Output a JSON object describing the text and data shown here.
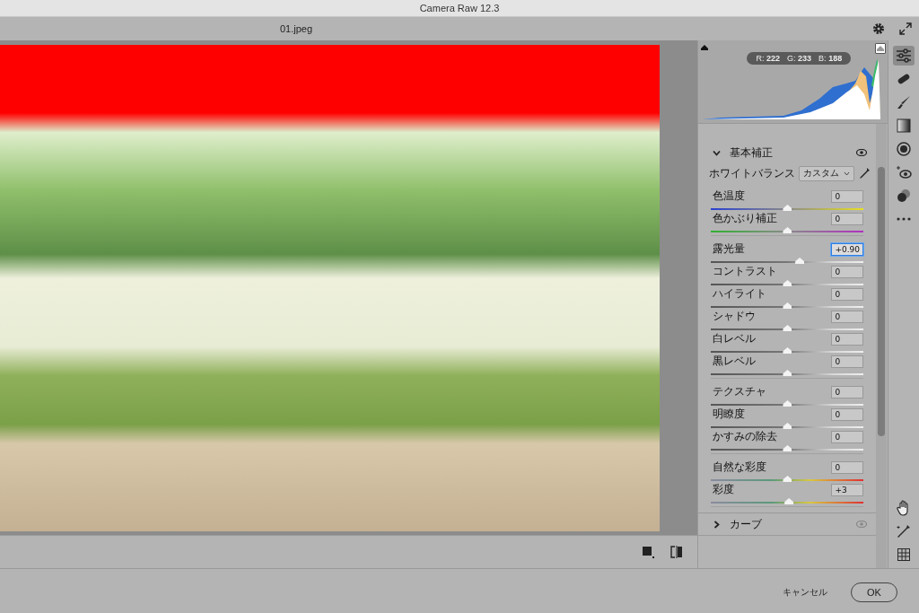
{
  "window": {
    "title": "Camera Raw 12.3"
  },
  "toolbar": {
    "filename": "01.jpeg"
  },
  "histogram": {
    "readout": [
      {
        "label": "R:",
        "value": "222"
      },
      {
        "label": "G:",
        "value": "233"
      },
      {
        "label": "B:",
        "value": "188"
      }
    ],
    "shadow_clipping_on": false,
    "highlight_clipping_on": true
  },
  "basic_panel": {
    "title": "基本補正",
    "expanded": true,
    "white_balance": {
      "label": "ホワイトバランス",
      "value": "カスタム"
    },
    "groups": [
      [
        {
          "label": "色温度",
          "value": "0",
          "level": 0.5,
          "kind": "temperature",
          "focused": false
        },
        {
          "label": "色かぶり補正",
          "value": "0",
          "level": 0.5,
          "kind": "tint",
          "focused": false
        }
      ],
      [
        {
          "label": "露光量",
          "value": "+0.90",
          "level": 0.58,
          "kind": "gray",
          "focused": true
        },
        {
          "label": "コントラスト",
          "value": "0",
          "level": 0.5,
          "kind": "gray",
          "focused": false
        },
        {
          "label": "ハイライト",
          "value": "0",
          "level": 0.5,
          "kind": "gray",
          "focused": false
        },
        {
          "label": "シャドウ",
          "value": "0",
          "level": 0.5,
          "kind": "gray",
          "focused": false
        },
        {
          "label": "白レベル",
          "value": "0",
          "level": 0.5,
          "kind": "gray",
          "focused": false
        },
        {
          "label": "黒レベル",
          "value": "0",
          "level": 0.5,
          "kind": "gray",
          "focused": false
        }
      ],
      [
        {
          "label": "テクスチャ",
          "value": "0",
          "level": 0.5,
          "kind": "gray",
          "focused": false
        },
        {
          "label": "明瞭度",
          "value": "0",
          "level": 0.5,
          "kind": "gray",
          "focused": false
        },
        {
          "label": "かすみの除去",
          "value": "0",
          "level": 0.5,
          "kind": "gray",
          "focused": false
        }
      ],
      [
        {
          "label": "自然な彩度",
          "value": "0",
          "level": 0.5,
          "kind": "vibrance",
          "focused": false
        },
        {
          "label": "彩度",
          "value": "+3",
          "level": 0.51,
          "kind": "vibrance",
          "focused": false
        }
      ]
    ]
  },
  "collapsed_panels": [
    {
      "title": "カーブ",
      "expanded": false
    }
  ],
  "tools": [
    {
      "kind": "sliders",
      "selected": true
    },
    {
      "kind": "heal",
      "selected": false
    },
    {
      "kind": "brush",
      "selected": false
    },
    {
      "kind": "gradient",
      "selected": false
    },
    {
      "kind": "radial",
      "selected": false
    },
    {
      "kind": "redeye",
      "selected": false
    },
    {
      "kind": "presets",
      "selected": false
    },
    {
      "kind": "more",
      "selected": false
    }
  ],
  "bottom_tools": [
    {
      "kind": "hand",
      "selected": false
    },
    {
      "kind": "sampler",
      "selected": false
    },
    {
      "kind": "grid",
      "selected": false
    }
  ],
  "footer": {
    "cancel": "キャンセル",
    "ok": "OK"
  }
}
